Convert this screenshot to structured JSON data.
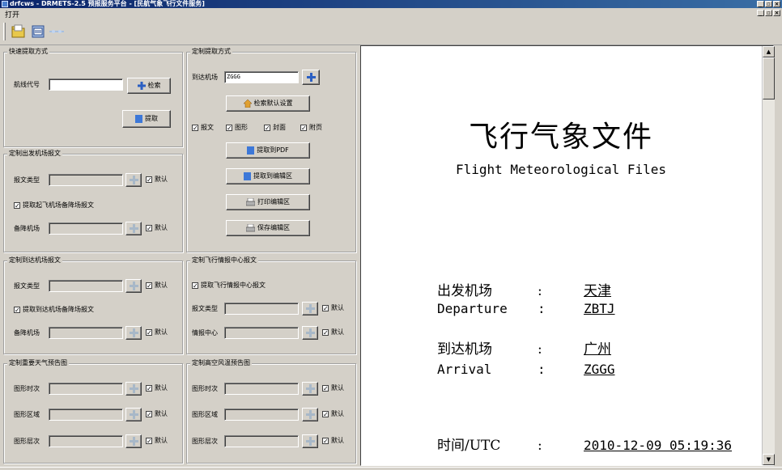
{
  "window": {
    "title": "drfcws - DRMETS-2.5 预报服务平台 - [民航气象飞行文件服务]"
  },
  "menu": {
    "open": "打开"
  },
  "toolbar": {
    "icons": [
      "open-folder-icon",
      "document-icon",
      "connection-icon"
    ]
  },
  "quick": {
    "legend": "快速提取方式",
    "flight_label": "航线代号",
    "flight_value": "",
    "search_button": "检索",
    "extract_button": "提取"
  },
  "custom": {
    "legend": "定制提取方式",
    "arrival_label": "到达机场",
    "arrival_value": "ZGGG",
    "default_search_button": "检索默认设置",
    "opt_report": "报文",
    "opt_graphic": "图形",
    "opt_cover": "封面",
    "opt_appendix": "附页",
    "pdf_button": "提取到PDF",
    "edit_button": "提取到编辑区",
    "print_button": "打印编辑区",
    "save_button": "保存编辑区"
  },
  "dep": {
    "legend": "定制出发机场报文",
    "type_label": "报文类型",
    "type_value": "",
    "default": "默认",
    "alt_check": "提取起飞机场备降场报文",
    "alt_label": "备降机场",
    "alt_value": ""
  },
  "arr": {
    "legend": "定制到达机场报文",
    "type_label": "报文类型",
    "type_value": "",
    "default": "默认",
    "alt_check": "提取到达机场备降场报文",
    "alt_label": "备降机场",
    "alt_value": ""
  },
  "fic": {
    "legend": "定制飞行情报中心报文",
    "check": "提取飞行情报中心报文",
    "type_label": "报文类型",
    "type_value": "",
    "center_label": "情报中心",
    "center_value": "",
    "default": "默认"
  },
  "sigwx": {
    "legend": "定制重要天气预告图",
    "time_label": "图形时次",
    "area_label": "图形区域",
    "level_label": "图形层次",
    "default": "默认"
  },
  "wind": {
    "legend": "定制高空风温预告图",
    "time_label": "图形时次",
    "area_label": "图形区域",
    "level_label": "图形层次",
    "default": "默认"
  },
  "document": {
    "title": "飞行气象文件",
    "subtitle": "Flight Meteorological Files",
    "dep_label_cn": "出发机场",
    "dep_label_en": "Departure",
    "dep_value_cn": "天津",
    "dep_value_code": "ZBTJ",
    "arr_label_cn": "到达机场",
    "arr_label_en": "Arrival",
    "arr_value_cn": "广州",
    "arr_value_code": "ZGGG",
    "time_label": "时间/UTC",
    "time_value": "2010-12-09 05:19:36",
    "colon": ":"
  }
}
